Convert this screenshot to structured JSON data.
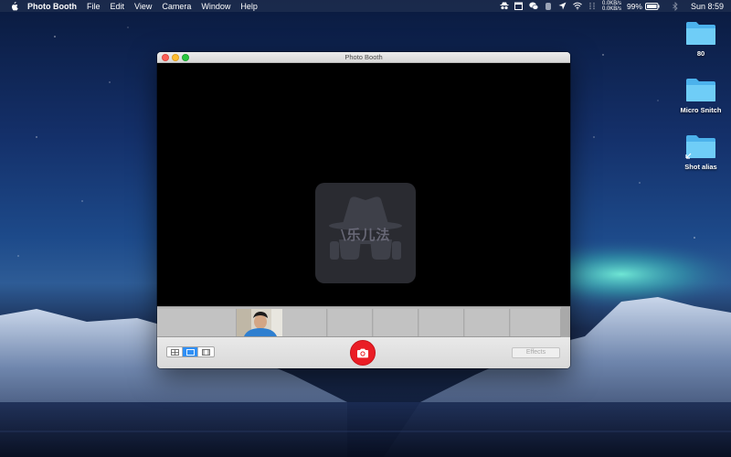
{
  "menubar": {
    "apple_icon": "apple-logo-icon",
    "app_name": "Photo Booth",
    "items": [
      "File",
      "Edit",
      "View",
      "Camera",
      "Window",
      "Help"
    ],
    "status": {
      "net_up": "0.0KB/s",
      "net_down": "0.0KB/s",
      "battery_percent": "99%",
      "clock": "Sun 8:59"
    }
  },
  "desktop": {
    "items": [
      {
        "label": "80",
        "icon": "folder-icon"
      },
      {
        "label": "Micro Snitch",
        "icon": "folder-icon"
      },
      {
        "label": "Shot alias",
        "icon": "folder-alias-icon"
      }
    ]
  },
  "window": {
    "title": "Photo Booth",
    "camera_view": {
      "privacy_icon": "incognito-spy-icon",
      "watermark": "\\乐儿法"
    },
    "filmstrip": {
      "thumbnail": "photo-thumbnail-person"
    },
    "toolbar": {
      "view_modes": [
        "four-up-icon",
        "single-photo-icon",
        "video-clip-icon"
      ],
      "active_mode": 1,
      "effects_label": "Effects"
    }
  },
  "colors": {
    "accent": "#2f8ff5",
    "shutter": "#ea1d25",
    "folder": "#5ac8fa"
  }
}
